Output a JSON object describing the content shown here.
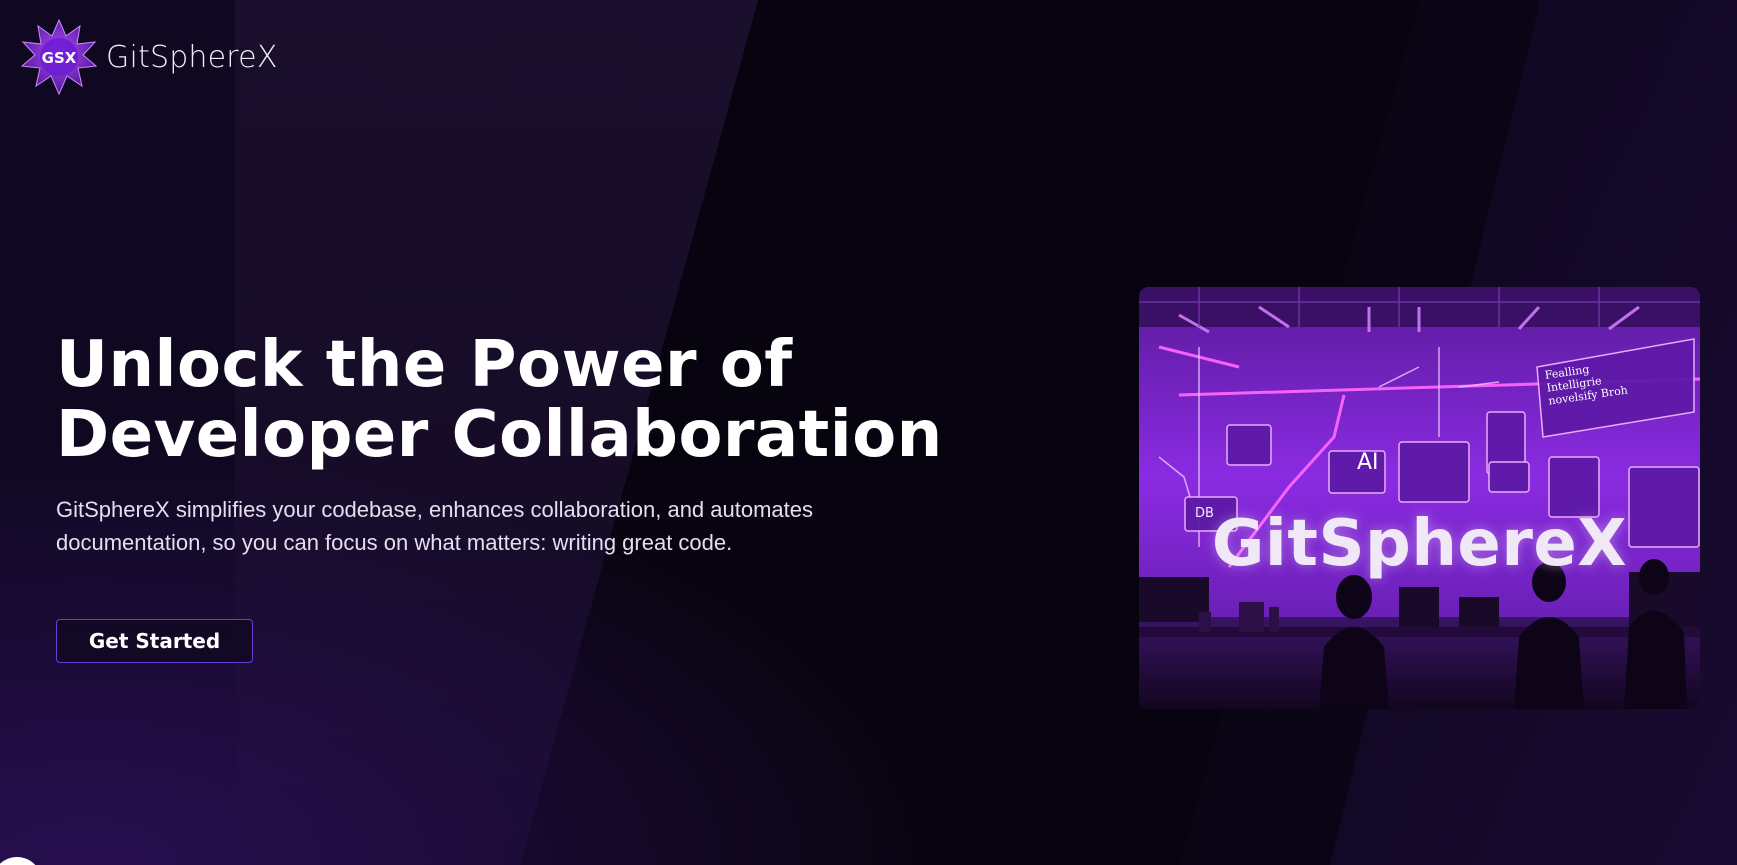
{
  "brand": {
    "logo_badge": "GSX",
    "name": "GitSphereX"
  },
  "hero": {
    "title_line1": "Unlock the Power of",
    "title_line2": "Developer Collaboration",
    "subtitle": "GitSphereX simplifies your codebase, enhances collaboration, and automates documentation, so you can focus on what matters: writing great code.",
    "cta_label": "Get Started"
  },
  "illustration": {
    "brand_text": "GitSphereX",
    "ai_label": "AI",
    "db_label": "DB",
    "panel_text": "Fealling Intelligrie novelsify Broh"
  },
  "colors": {
    "background": "#07030f",
    "accent": "#6a3fd6",
    "illustration_purple": "#8a2be2"
  },
  "icons": {
    "logo": "starburst-badge-icon"
  }
}
